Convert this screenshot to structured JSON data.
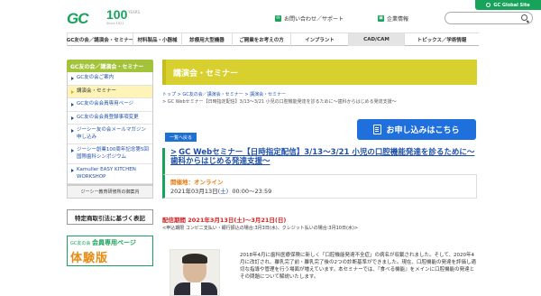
{
  "header": {
    "logo_text": "GC",
    "anniv_number": "100",
    "anniv_sub": "YEARS",
    "anniv_since": "Since 1921",
    "global_site": "GC Global Site",
    "contact_link": "お問い合わせ／サポート",
    "company_link": "企業情報"
  },
  "nav": {
    "items": [
      {
        "label": "GC友の会／講演会・セミナー",
        "w": 73
      },
      {
        "label": "材料製品・小器械",
        "w": 54
      },
      {
        "label": "診療用大型機器",
        "w": 56
      },
      {
        "label": "ご開業をお考えの方",
        "w": 65
      },
      {
        "label": "インプラント",
        "w": 64
      },
      {
        "label": "CAD/CAM",
        "w": 62
      },
      {
        "label": "トピックス／学術情報",
        "w": 83
      }
    ]
  },
  "sidebar": {
    "heading": "GC友の会／講演会・セミナー",
    "items": [
      {
        "label": "GC友の会ご案内",
        "active": false
      },
      {
        "label": "講演会・セミナー",
        "active": true
      },
      {
        "label": "GC友の会会員専用ページ",
        "active": false
      },
      {
        "label": "GC友の会会員登録事項変更",
        "active": false
      },
      {
        "label": "ジーシー友の会メールマガジン申し込み",
        "active": false
      },
      {
        "label": "ジーシー創業100周年記念第5回国際歯科シンポジウム",
        "active": false
      },
      {
        "label": "Kamuller EASY KITCHEN WORKSHOP",
        "active": false
      }
    ],
    "sub_link": "ジーシー教育研修所の御案内",
    "law_button": "特定商取引法に基づく表記",
    "banner_small": "GC友の会",
    "banner_mid": "会員専用ページ",
    "banner_big": "体験版"
  },
  "main": {
    "page_title": "講演会・セミナー",
    "breadcrumb_1": "トップ",
    "breadcrumb_2": "GC友の会／講演会・セミナー",
    "breadcrumb_3": "講演会・セミナー",
    "breadcrumb_current": "GC Webセミナー【日時指定配信】3/13～3/21 小児の口腔機能発達を診るために～歯科からはじめる発達支援～",
    "back_button": "一覧へ戻る",
    "apply_button": "お申し込みはこちら",
    "event_title": "GC Webセミナー【日時指定配信】3/13～3/21 小児の口腔機能発達を診るために～歯科からはじめる発達支援～",
    "venue_label": "開催地：",
    "venue_value": "オンライン",
    "date_text": "2021年03月13日",
    "date_day": "(土)",
    "date_time": "00:00～23:59",
    "period_text": "配信期間 2021年3月13日(土)～3月21日(日)",
    "period_note": "<申込期限 コンビニ支払い・銀行振込の場合:3月3日(水)、クレジット払いの場合:3月10日(水)>",
    "description": "2018年4月に歯科医療保険に新しく「口腔機能発達不全症」の病名が収載されました。そして、2020年4月に改訂され、離乳完了前・離乳完了後の2つの診断基準ができました。現在、口腔機能の発達を評価し適切な指導や管理を行う場面が増えています。本セミナーでは、『食べる機能』をメインに口腔機能の発達とその問題について解説いたします。"
  },
  "colors": {
    "brand_green": "#17a35a",
    "title_yellow": "#d8d02e",
    "link_blue": "#1e4fa8",
    "apply_blue": "#1f6fdc",
    "period_red": "#d52020"
  }
}
